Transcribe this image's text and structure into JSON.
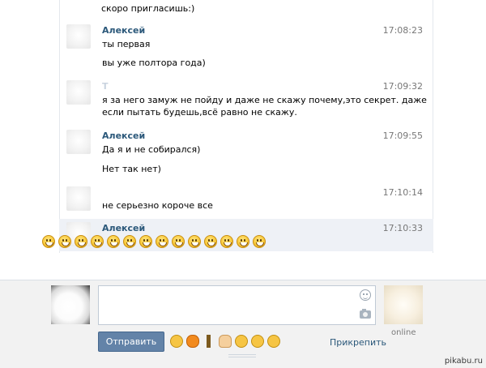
{
  "previous_line": "скоро пригласишь:)",
  "messages": [
    {
      "author": "Алексей",
      "time": "17:08:23",
      "lines": [
        "ты первая",
        "вы уже полтора года)"
      ]
    },
    {
      "author": "Т",
      "time": "17:09:32",
      "lines": [
        "я за него замуж не пойду и даже не скажу почему,это секрет. даже",
        "если пытать будешь,всё равно не скажу."
      ]
    },
    {
      "author": "Алексей",
      "time": "17:09:55",
      "lines": [
        "Да я и не собирался)",
        "Нет так нет)"
      ]
    },
    {
      "author": "",
      "time": "17:10:14",
      "lines": [
        "не серьезно короче все"
      ]
    },
    {
      "author": "Алексей",
      "time": "17:10:33",
      "lines": []
    }
  ],
  "smiley_count": 14,
  "composer": {
    "send_label": "Отправить",
    "attach_label": "Прикрепить",
    "online_label": "online",
    "emoji_icons": [
      "angry-face-icon",
      "pumpkin-icon",
      "bottle-icon",
      "raised-hand-icon",
      "grinning-face-icon",
      "crying-face-icon",
      "kissing-face-icon"
    ]
  },
  "watermark": "pikabu.ru"
}
